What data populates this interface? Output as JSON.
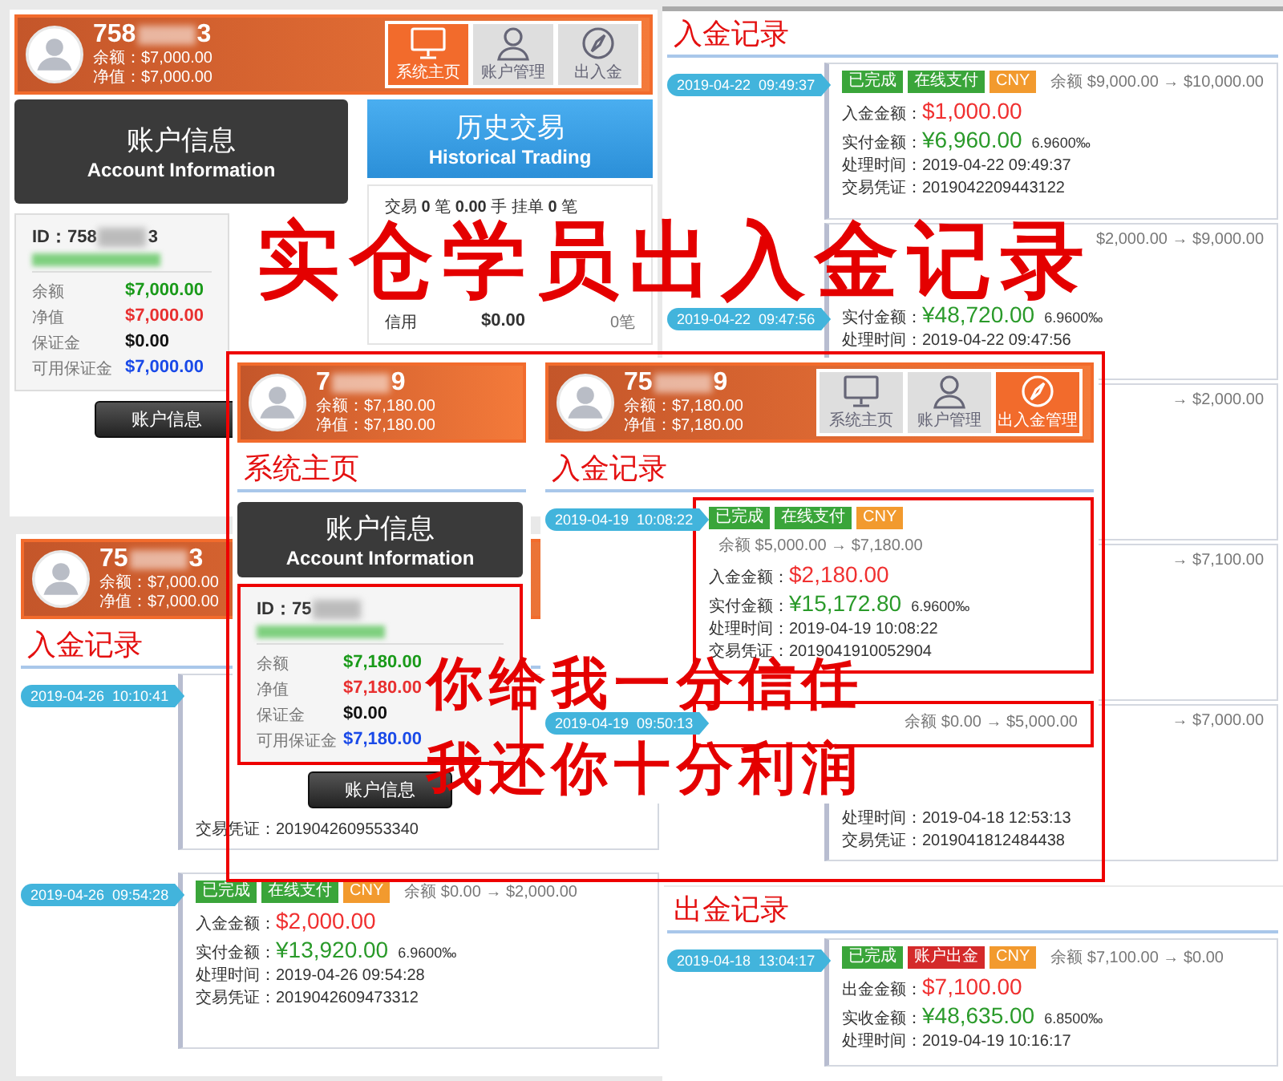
{
  "screens": [
    {
      "header": {
        "id_start": "758",
        "id_end": "3",
        "lines": [
          "余额：$7,000.00",
          "净值：$7,000.00"
        ]
      },
      "nav": [
        {
          "kind": "monitor",
          "label": "系统主页",
          "selected": true
        },
        {
          "kind": "person",
          "label": "账户管理",
          "selected": false
        },
        {
          "kind": "compass",
          "label": "出入金",
          "selected": false
        }
      ],
      "account": {
        "title": "账户信息",
        "subtitle": "Account Information",
        "id_start": "ID：758",
        "id_end": "3",
        "marked": false,
        "button": "账户信息",
        "rows": [
          {
            "label": "余额",
            "value": "$7,000.00",
            "color": "#1a9a1a"
          },
          {
            "label": "净值",
            "value": "$7,000.00",
            "color": "#e83030"
          },
          {
            "label": "保证金",
            "value": "$0.00",
            "color": "#111111"
          },
          {
            "label": "可用保证金",
            "value": "$7,000.00",
            "color": "#1a4ae8"
          }
        ]
      },
      "history": {
        "title": "历史交易",
        "subtitle": "Historical Trading",
        "stats": "交易 **0** 笔  **0.00** 手  挂单 **0** 笔",
        "rows": [
          {
            "label": "信用",
            "value": "$0.00",
            "count": "0笔"
          }
        ]
      }
    },
    {
      "title": "入金记录",
      "entries": [
        {
          "badge": "2019-04-22  09:49:37",
          "tags": [
            {
              "label": "已完成",
              "color": "#3aa53a"
            },
            {
              "label": "在线支付",
              "color": "#3aa53a"
            },
            {
              "label": "CNY",
              "color": "#f29a2e"
            }
          ],
          "balance": "余额 $9,000.00 → $10,000.00",
          "lines": [
            {
              "kind": "amount",
              "label": "入金金额：",
              "value": "$1,000.00"
            },
            {
              "kind": "paid",
              "label": "实付金额：",
              "value": "¥6,960.00",
              "note": "6.9600‰"
            },
            {
              "kind": "plain",
              "label": "处理时间：",
              "value": "2019-04-22 09:49:37"
            },
            {
              "kind": "plain",
              "label": "交易凭证：",
              "value": "2019042209443122"
            }
          ]
        },
        {
          "badge": "2019-04-22  09:47:56",
          "balance": "$2,000.00 → $9,000.00",
          "lines": [
            {
              "kind": "paid",
              "label": "实付金额：",
              "value": "¥48,720.00",
              "note": "6.9600‰"
            },
            {
              "kind": "plain",
              "label": "处理时间：",
              "value": "2019-04-22 09:47:56"
            }
          ]
        },
        {
          "balance": "→ $2,000.00"
        },
        {
          "balance": "→ $7,100.00"
        },
        {
          "balance": "→ $7,000.00",
          "lines": [
            {
              "kind": "plain",
              "label": "处理时间：",
              "value": "2019-04-18 12:53:13"
            },
            {
              "kind": "plain",
              "label": "交易凭证：",
              "value": "2019041812484438"
            }
          ]
        }
      ]
    },
    {
      "header": {
        "id_start": "75",
        "id_end": "3",
        "lines": [
          "余额：$7,000.00",
          "净值：$7,000.00"
        ]
      },
      "title": "入金记录",
      "entries": [
        {
          "badge": "2019-04-26  10:10:41",
          "lines": [
            {
              "kind": "plain",
              "label": "交易凭证：",
              "value": "2019042609553340"
            }
          ]
        },
        {
          "badge": "2019-04-26  09:54:28",
          "tags": [
            {
              "label": "已完成",
              "color": "#3aa53a"
            },
            {
              "label": "在线支付",
              "color": "#3aa53a"
            },
            {
              "label": "CNY",
              "color": "#f29a2e"
            }
          ],
          "balance": "余额 $0.00 → $2,000.00",
          "lines": [
            {
              "kind": "amount",
              "label": "入金金额：",
              "value": "$2,000.00"
            },
            {
              "kind": "paid",
              "label": "实付金额：",
              "value": "¥13,920.00",
              "note": "6.9600‰"
            },
            {
              "kind": "plain",
              "label": "处理时间：",
              "value": "2019-04-26 09:54:28"
            },
            {
              "kind": "plain",
              "label": "交易凭证：",
              "value": "2019042609473312"
            }
          ]
        }
      ]
    },
    {
      "title": "出金记录",
      "entries": [
        {
          "badge": "2019-04-18  13:04:17",
          "tags": [
            {
              "label": "已完成",
              "color": "#3aa53a"
            },
            {
              "label": "账户出金",
              "color": "#d42a2a"
            },
            {
              "label": "CNY",
              "color": "#f29a2e"
            }
          ],
          "balance": "余额 $7,100.00 → $0.00",
          "lines": [
            {
              "kind": "amount",
              "label": "出金金额：",
              "value": "$7,100.00"
            },
            {
              "kind": "paid",
              "label": "实收金额：",
              "value": "¥48,635.00",
              "note": "6.8500‰"
            },
            {
              "kind": "plain",
              "label": "处理时间：",
              "value": "2019-04-19 10:16:17"
            }
          ]
        }
      ]
    }
  ],
  "group": {
    "screens": [
      {
        "header": {
          "id_start": "7",
          "id_end": "9",
          "lines": [
            "余额：$7,180.00",
            "净值：$7,180.00"
          ]
        },
        "title": "系统主页",
        "account": {
          "title": "账户信息",
          "subtitle": "Account Information",
          "id_start": "ID：75",
          "marked": true,
          "button": "账户信息",
          "rows": [
            {
              "label": "余额",
              "value": "$7,180.00",
              "color": "#1a9a1a"
            },
            {
              "label": "净值",
              "value": "$7,180.00",
              "color": "#e83030"
            },
            {
              "label": "保证金",
              "value": "$0.00",
              "color": "#111111"
            },
            {
              "label": "可用保证金",
              "value": "$7,180.00",
              "color": "#1a4ae8"
            }
          ]
        }
      },
      {
        "header": {
          "id_start": "75",
          "id_end": "9",
          "lines": [
            "余额：$7,180.00",
            "净值：$7,180.00"
          ]
        },
        "nav": [
          {
            "kind": "monitor",
            "label": "系统主页",
            "selected": false
          },
          {
            "kind": "person",
            "label": "账户管理",
            "selected": false
          },
          {
            "kind": "compass",
            "label": "出入金管理",
            "selected": true
          }
        ],
        "title": "入金记录",
        "entries": [
          {
            "badge": "2019-04-19  10:08:22",
            "marked": true,
            "tags": [
              {
                "label": "已完成",
                "color": "#3aa53a"
              },
              {
                "label": "在线支付",
                "color": "#3aa53a"
              },
              {
                "label": "CNY",
                "color": "#f29a2e"
              }
            ],
            "balance": "余额 $5,000.00 → $7,180.00",
            "lines": [
              {
                "kind": "amount",
                "label": "入金金额：",
                "value": "$2,180.00"
              },
              {
                "kind": "paid",
                "label": "实付金额：",
                "value": "¥15,172.80",
                "note": "6.9600‰"
              },
              {
                "kind": "plain",
                "label": "处理时间：",
                "value": "2019-04-19 10:08:22"
              },
              {
                "kind": "plain",
                "label": "交易凭证：",
                "value": "2019041910052904"
              }
            ]
          },
          {
            "badge": "2019-04-19  09:50:13",
            "marked": true,
            "balance": "余额 $0.00 → $5,000.00"
          }
        ]
      }
    ]
  },
  "captions": [
    "实仓学员出入金记录",
    "你给我一分信任",
    "我还你十分利润"
  ]
}
